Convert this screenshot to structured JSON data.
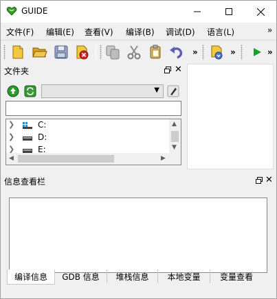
{
  "window": {
    "title": "GUIDE"
  },
  "menu": {
    "items": [
      "文件(F)",
      "编辑(E)",
      "查看(V)",
      "编译(B)",
      "调试(D)",
      "语言(L)"
    ],
    "more": "»"
  },
  "toolbar": {
    "buttons": [
      "new-file",
      "open-folder",
      "save",
      "close-file",
      "copy",
      "cut",
      "paste",
      "undo",
      "build",
      "run"
    ],
    "overflow": "»"
  },
  "file_panel": {
    "title": "文件夹",
    "path_value": "",
    "combo_value": "",
    "tree": [
      {
        "label": "C:"
      },
      {
        "label": "D:"
      },
      {
        "label": "E:"
      }
    ]
  },
  "info_panel": {
    "title": "信息查看栏",
    "tabs": [
      "编译信息",
      "GDB 信息",
      "堆栈信息",
      "本地变量",
      "变量查看"
    ],
    "active_tab": "编译信息"
  },
  "colors": {
    "heart": "#3a9a2a",
    "run_green": "#1aa02a",
    "gold": "#e0b020"
  }
}
